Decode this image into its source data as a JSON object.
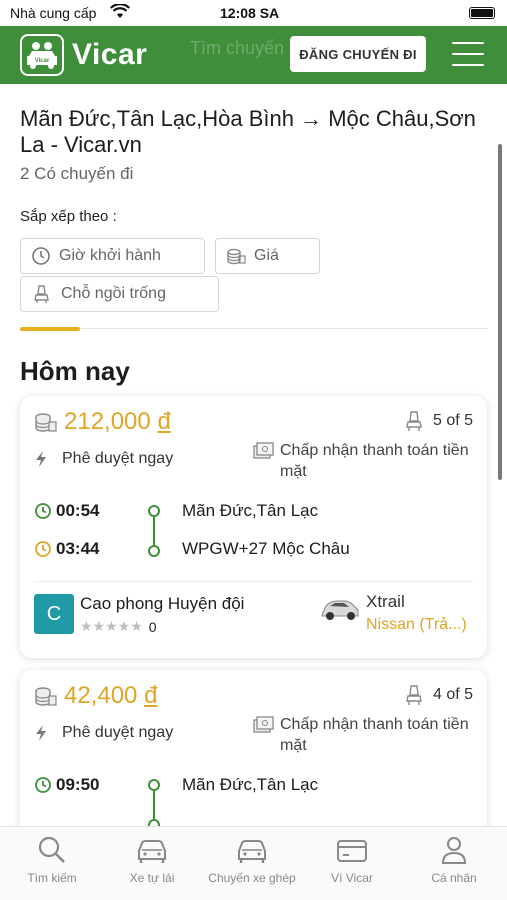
{
  "status_bar": {
    "carrier": "Nhà cung cấp",
    "time": "12:08 SA"
  },
  "header": {
    "logo_text": "Vicar",
    "logo_badge_text": "Vicar",
    "ghost_text": "Tìm chuyến",
    "post_trip_button": "ĐĂNG CHUYẾN ĐI",
    "brand_color": "#3e8e3a"
  },
  "route": {
    "title": "Mãn Đức,Tân Lạc,Hòa Bình → Mộc Châu,Sơn La - Vicar.vn",
    "trip_count": "2 Có chuyến đi"
  },
  "sort": {
    "label": "Sắp xếp theo :",
    "options": [
      {
        "label": "Giờ khởi hành",
        "icon": "clock-icon"
      },
      {
        "label": "Giá",
        "icon": "coins-icon"
      },
      {
        "label": "Chỗ ngồi trống",
        "icon": "seat-icon"
      }
    ]
  },
  "section_title": "Hôm nay",
  "trips": [
    {
      "price": "212,000",
      "currency": "đ",
      "seats": "5 of 5",
      "instant_label": "Phê duyệt ngay",
      "payment": "Chấp nhận thanh toán tiền mặt",
      "depart_time": "00:54",
      "arrive_time": "03:44",
      "from": "Mãn Đức,Tân Lạc",
      "to": "WPGW+27 Mộc Châu",
      "driver_initial": "C",
      "driver_name": "Cao phong Huyện đội",
      "stars": "★★★★★",
      "rating": "0",
      "car_model": "Xtrail",
      "car_make": "Nissan (Trả...)"
    },
    {
      "price": "42,400",
      "currency": "đ",
      "seats": "4 of 5",
      "instant_label": "Phê duyệt ngay",
      "payment": "Chấp nhận thanh toán tiền mặt",
      "depart_time": "09:50",
      "from": "Mãn Đức,Tân Lạc"
    }
  ],
  "tabs": [
    {
      "label": "Tìm kiếm",
      "icon": "search-icon"
    },
    {
      "label": "Xe tự lái",
      "icon": "car-icon"
    },
    {
      "label": "Chuyến xe ghép",
      "icon": "carpool-icon"
    },
    {
      "label": "Ví Vicar",
      "icon": "wallet-icon"
    },
    {
      "label": "Cá nhân",
      "icon": "user-icon"
    }
  ],
  "accent_color": "#e0a526"
}
